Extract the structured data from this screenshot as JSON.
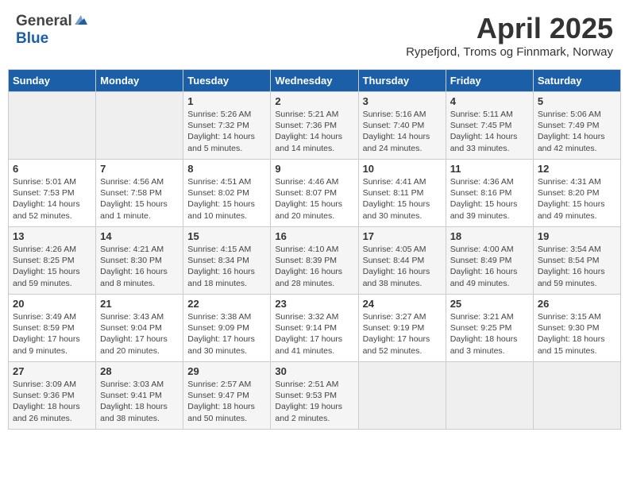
{
  "header": {
    "logo_general": "General",
    "logo_blue": "Blue",
    "month_title": "April 2025",
    "location": "Rypefjord, Troms og Finnmark, Norway"
  },
  "days_of_week": [
    "Sunday",
    "Monday",
    "Tuesday",
    "Wednesday",
    "Thursday",
    "Friday",
    "Saturday"
  ],
  "weeks": [
    [
      {
        "day": "",
        "info": ""
      },
      {
        "day": "",
        "info": ""
      },
      {
        "day": "1",
        "info": "Sunrise: 5:26 AM\nSunset: 7:32 PM\nDaylight: 14 hours and 5 minutes."
      },
      {
        "day": "2",
        "info": "Sunrise: 5:21 AM\nSunset: 7:36 PM\nDaylight: 14 hours and 14 minutes."
      },
      {
        "day": "3",
        "info": "Sunrise: 5:16 AM\nSunset: 7:40 PM\nDaylight: 14 hours and 24 minutes."
      },
      {
        "day": "4",
        "info": "Sunrise: 5:11 AM\nSunset: 7:45 PM\nDaylight: 14 hours and 33 minutes."
      },
      {
        "day": "5",
        "info": "Sunrise: 5:06 AM\nSunset: 7:49 PM\nDaylight: 14 hours and 42 minutes."
      }
    ],
    [
      {
        "day": "6",
        "info": "Sunrise: 5:01 AM\nSunset: 7:53 PM\nDaylight: 14 hours and 52 minutes."
      },
      {
        "day": "7",
        "info": "Sunrise: 4:56 AM\nSunset: 7:58 PM\nDaylight: 15 hours and 1 minute."
      },
      {
        "day": "8",
        "info": "Sunrise: 4:51 AM\nSunset: 8:02 PM\nDaylight: 15 hours and 10 minutes."
      },
      {
        "day": "9",
        "info": "Sunrise: 4:46 AM\nSunset: 8:07 PM\nDaylight: 15 hours and 20 minutes."
      },
      {
        "day": "10",
        "info": "Sunrise: 4:41 AM\nSunset: 8:11 PM\nDaylight: 15 hours and 30 minutes."
      },
      {
        "day": "11",
        "info": "Sunrise: 4:36 AM\nSunset: 8:16 PM\nDaylight: 15 hours and 39 minutes."
      },
      {
        "day": "12",
        "info": "Sunrise: 4:31 AM\nSunset: 8:20 PM\nDaylight: 15 hours and 49 minutes."
      }
    ],
    [
      {
        "day": "13",
        "info": "Sunrise: 4:26 AM\nSunset: 8:25 PM\nDaylight: 15 hours and 59 minutes."
      },
      {
        "day": "14",
        "info": "Sunrise: 4:21 AM\nSunset: 8:30 PM\nDaylight: 16 hours and 8 minutes."
      },
      {
        "day": "15",
        "info": "Sunrise: 4:15 AM\nSunset: 8:34 PM\nDaylight: 16 hours and 18 minutes."
      },
      {
        "day": "16",
        "info": "Sunrise: 4:10 AM\nSunset: 8:39 PM\nDaylight: 16 hours and 28 minutes."
      },
      {
        "day": "17",
        "info": "Sunrise: 4:05 AM\nSunset: 8:44 PM\nDaylight: 16 hours and 38 minutes."
      },
      {
        "day": "18",
        "info": "Sunrise: 4:00 AM\nSunset: 8:49 PM\nDaylight: 16 hours and 49 minutes."
      },
      {
        "day": "19",
        "info": "Sunrise: 3:54 AM\nSunset: 8:54 PM\nDaylight: 16 hours and 59 minutes."
      }
    ],
    [
      {
        "day": "20",
        "info": "Sunrise: 3:49 AM\nSunset: 8:59 PM\nDaylight: 17 hours and 9 minutes."
      },
      {
        "day": "21",
        "info": "Sunrise: 3:43 AM\nSunset: 9:04 PM\nDaylight: 17 hours and 20 minutes."
      },
      {
        "day": "22",
        "info": "Sunrise: 3:38 AM\nSunset: 9:09 PM\nDaylight: 17 hours and 30 minutes."
      },
      {
        "day": "23",
        "info": "Sunrise: 3:32 AM\nSunset: 9:14 PM\nDaylight: 17 hours and 41 minutes."
      },
      {
        "day": "24",
        "info": "Sunrise: 3:27 AM\nSunset: 9:19 PM\nDaylight: 17 hours and 52 minutes."
      },
      {
        "day": "25",
        "info": "Sunrise: 3:21 AM\nSunset: 9:25 PM\nDaylight: 18 hours and 3 minutes."
      },
      {
        "day": "26",
        "info": "Sunrise: 3:15 AM\nSunset: 9:30 PM\nDaylight: 18 hours and 15 minutes."
      }
    ],
    [
      {
        "day": "27",
        "info": "Sunrise: 3:09 AM\nSunset: 9:36 PM\nDaylight: 18 hours and 26 minutes."
      },
      {
        "day": "28",
        "info": "Sunrise: 3:03 AM\nSunset: 9:41 PM\nDaylight: 18 hours and 38 minutes."
      },
      {
        "day": "29",
        "info": "Sunrise: 2:57 AM\nSunset: 9:47 PM\nDaylight: 18 hours and 50 minutes."
      },
      {
        "day": "30",
        "info": "Sunrise: 2:51 AM\nSunset: 9:53 PM\nDaylight: 19 hours and 2 minutes."
      },
      {
        "day": "",
        "info": ""
      },
      {
        "day": "",
        "info": ""
      },
      {
        "day": "",
        "info": ""
      }
    ]
  ]
}
